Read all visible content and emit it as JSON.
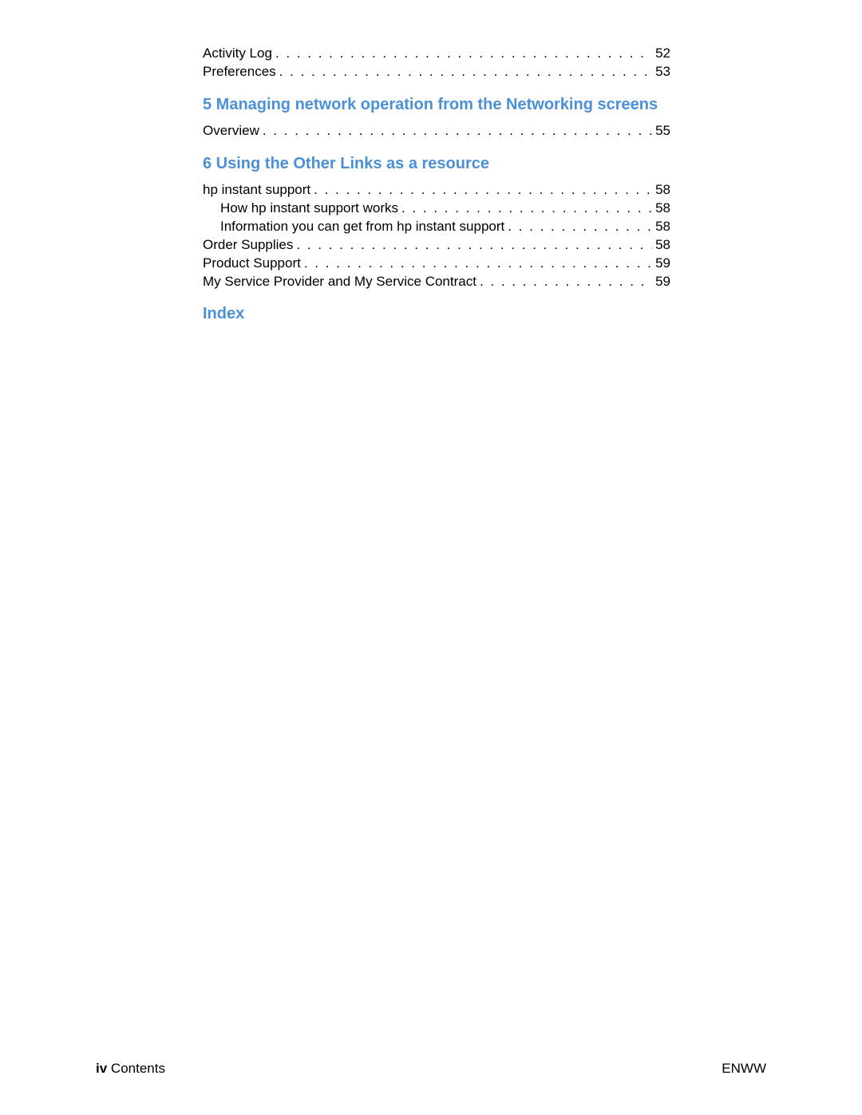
{
  "entries_top": [
    {
      "label": "Activity Log",
      "page": "52",
      "indent": 0
    },
    {
      "label": "Preferences",
      "page": "53",
      "indent": 0
    }
  ],
  "section5": {
    "heading": "5 Managing network operation from the Networking screens",
    "entries": [
      {
        "label": "Overview",
        "page": "55",
        "indent": 0
      }
    ]
  },
  "section6": {
    "heading": "6 Using the Other Links as a resource",
    "entries": [
      {
        "label": "hp instant support",
        "page": "58",
        "indent": 0
      },
      {
        "label": "How hp instant support works",
        "page": "58",
        "indent": 1
      },
      {
        "label": "Information you can get from hp instant support",
        "page": "58",
        "indent": 1
      },
      {
        "label": "Order Supplies",
        "page": "58",
        "indent": 0
      },
      {
        "label": "Product Support",
        "page": "59",
        "indent": 0
      },
      {
        "label": "My Service Provider and My Service Contract",
        "page": "59",
        "indent": 0
      }
    ]
  },
  "index_heading": "Index",
  "footer": {
    "page_num": "iv",
    "section_label": "Contents",
    "right": "ENWW"
  }
}
